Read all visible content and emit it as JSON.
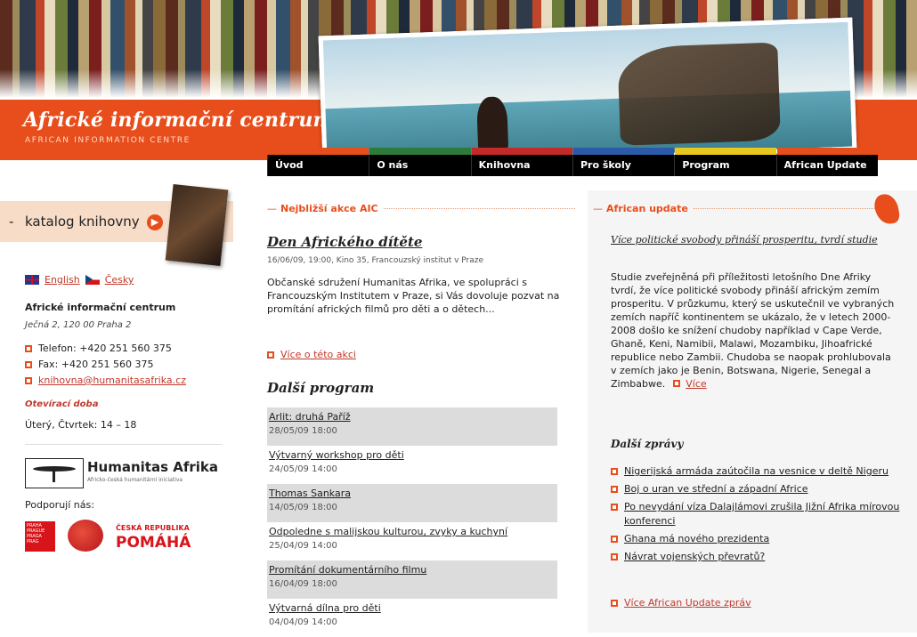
{
  "header": {
    "title": "Africké informační centrum",
    "subtitle": "AFRICAN INFORMATION CENTRE"
  },
  "nav": [
    "Úvod",
    "O nás",
    "Knihovna",
    "Pro školy",
    "Program",
    "African Update"
  ],
  "sidebar": {
    "catalog_label": "katalog knihovny",
    "languages": [
      "English",
      "Česky"
    ],
    "org_name": "Africké informační centrum",
    "address": "Ječná 2, 120 00 Praha 2",
    "phone": "Telefon: +420 251 560 375",
    "fax": "Fax: +420 251 560 375",
    "email": "knihovna@humanitasafrika.cz",
    "hours_title": "Otevírací doba",
    "hours": "Úterý, Čtvrtek: 14 – 18",
    "partner_name": "Humanitas Afrika",
    "partner_tagline": "Africko-česká humanitární iniciativa",
    "support_label": "Podporují nás:",
    "cr_small": "ČESKÁ REPUBLIKA",
    "cr_big": "POMÁHÁ",
    "praha_text": "PRAHA PRAGUE PRAGA PRAG"
  },
  "middle": {
    "section_title": "Nejbližší akce AIC",
    "event_title": "Den Afrického dítěte",
    "event_meta": "16/06/09, 19:00, Kino 35, Francouzský institut v Praze",
    "event_desc": "Občanské sdružení Humanitas Afrika, ve spolupráci s Francouzským Institutem v Praze, si Vás dovoluje pozvat na promítání afrických filmů pro děti a o dětech...",
    "event_more": "Více o této akci",
    "program_title": "Další program",
    "program": [
      {
        "title": "Arlit: druhá Paříž",
        "date": "28/05/09 18:00"
      },
      {
        "title": "Výtvarný workshop pro děti",
        "date": "24/05/09 14:00"
      },
      {
        "title": "Thomas Sankara",
        "date": "14/05/09 18:00"
      },
      {
        "title": "Odpoledne s malijskou kulturou, zvyky a kuchyní",
        "date": "25/04/09 14:00"
      },
      {
        "title": "Promítání dokumentárního filmu",
        "date": "16/04/09 18:00"
      },
      {
        "title": "Výtvarná dílna pro děti",
        "date": "04/04/09 14:00"
      }
    ]
  },
  "right": {
    "section_title": "African update",
    "headline": "Více politické svobody přináší prosperitu, tvrdí studie",
    "body": "Studie zveřejněná při příležitosti letošního Dne Afriky tvrdí, že více politické svobody přináší africkým zemím prosperitu. V průzkumu, který se uskutečnil ve vybraných zemích napříč kontinentem se ukázalo, že v letech 2000-2008 došlo ke snížení chudoby například v Cape Verde, Ghaně, Keni, Namibii, Malawi, Mozambiku, Jihoafrické republice nebo Zambii. Chudoba se naopak prohlubovala v zemích jako je Benin, Botswana, Nigerie, Senegal a Zimbabwe.",
    "body_more": "Více",
    "more_news_title": "Další zprávy",
    "news": [
      "Nigerijská armáda zaútočila na vesnice v deltě Nigeru",
      "Boj o uran ve střední a západní Africe",
      "Po nevydání víza Dalajlámovi zrušila Jižní Afrika mírovou konferenci",
      "Ghana má nového prezidenta",
      "Návrat vojenských převratů?"
    ],
    "all_news": "Více African Update zpráv"
  }
}
